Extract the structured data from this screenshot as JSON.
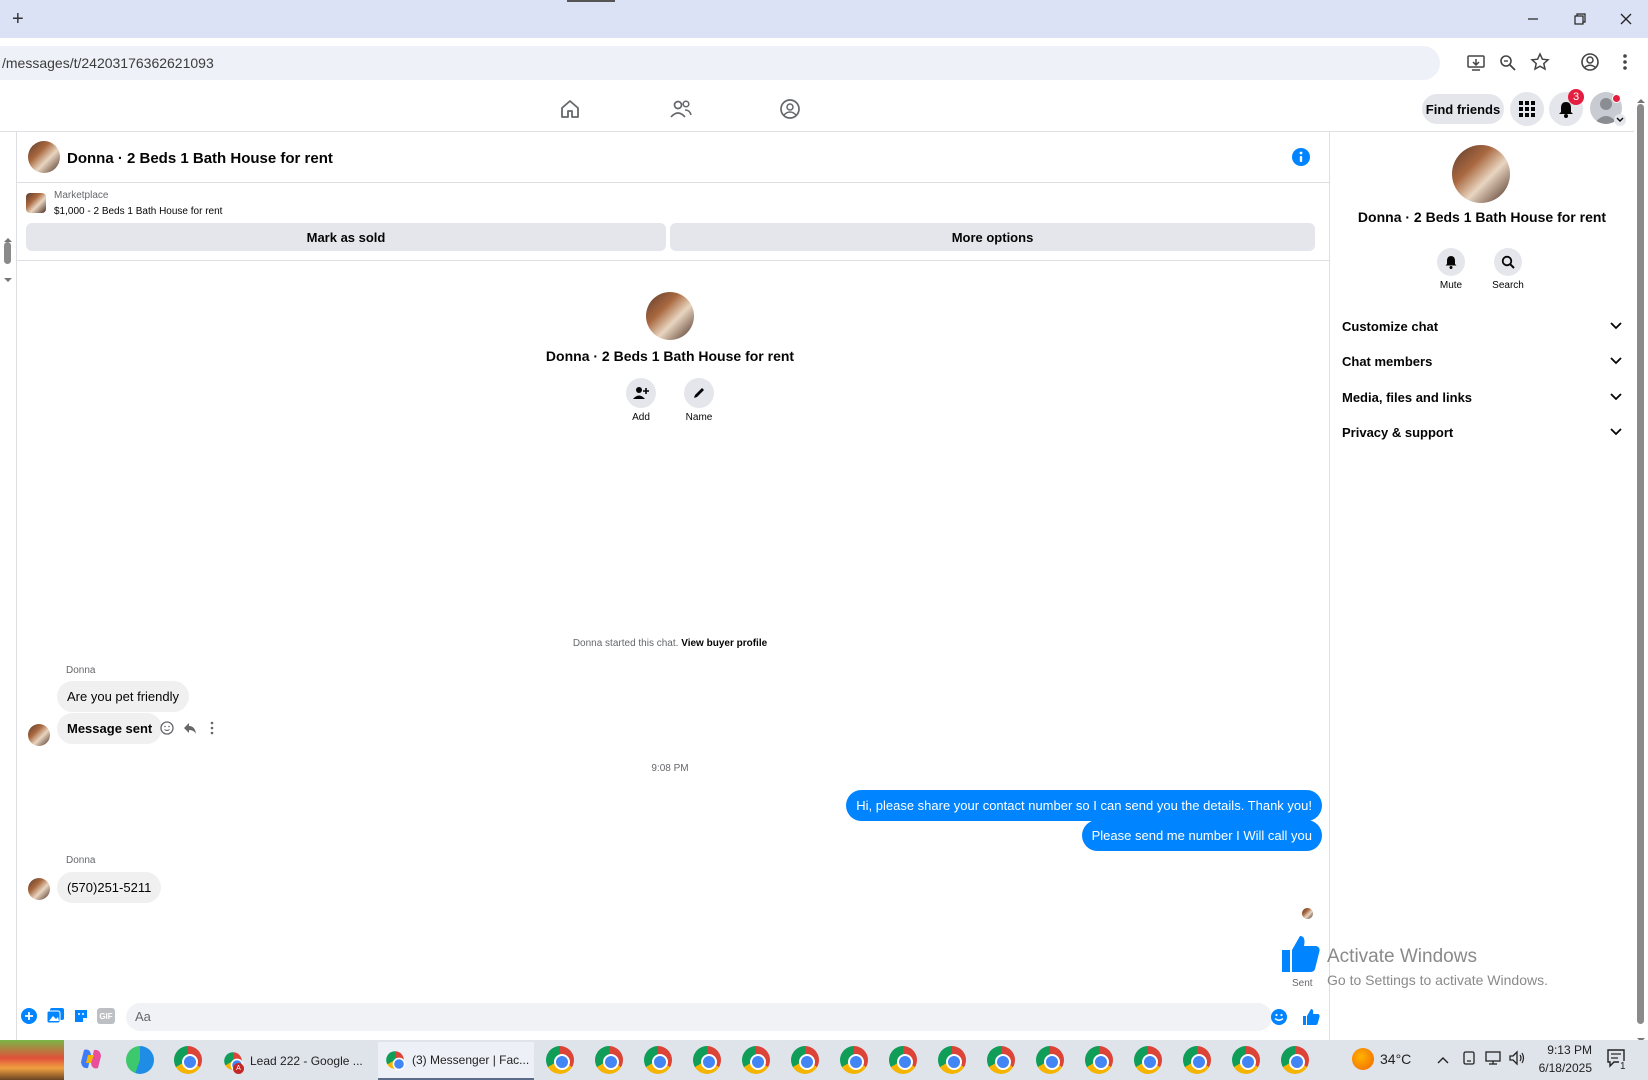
{
  "browser": {
    "url": "/messages/t/24203176362621093",
    "new_tab": "+"
  },
  "header": {
    "find_friends": "Find friends",
    "notification_count": "3"
  },
  "chat": {
    "title": "Donna · 2 Beds 1 Bath House for rent",
    "marketplace_label": "Marketplace",
    "listing": "$1,000 - 2 Beds 1 Bath House for rent",
    "mark_sold": "Mark as sold",
    "more_options": "More options",
    "intro_name": "Donna · 2 Beds 1 Bath House for rent",
    "add_label": "Add",
    "name_label": "Name",
    "started_text": "Donna started this chat.",
    "view_buyer": "View buyer profile",
    "messages": {
      "sender1": "Donna",
      "msg1": "Are you pet friendly",
      "msg2": "Message sent",
      "time": "9:08 PM",
      "out1": "Hi, please share your contact number so I can send you the details. Thank you!",
      "out2": "Please send me number I Will call you",
      "sender2": "Donna",
      "msg3": "(570)251-5211",
      "sent_label": "Sent"
    },
    "composer_placeholder": "Aa"
  },
  "rightpanel": {
    "name": "Donna · 2 Beds 1 Bath House for rent",
    "mute": "Mute",
    "search": "Search",
    "sections": [
      "Customize chat",
      "Chat members",
      "Media, files and links",
      "Privacy & support"
    ]
  },
  "watermark": {
    "line1": "Activate Windows",
    "line2": "Go to Settings to activate Windows."
  },
  "taskbar": {
    "tab1": "Lead 222 - Google ...",
    "tab2": "(3) Messenger | Fac...",
    "temp": "34°C",
    "time": "9:13 PM",
    "date": "6/18/2025",
    "notif_count": "1"
  },
  "colors": {
    "accent": "#0084ff",
    "fb_blue": "#1877f2",
    "badge_red": "#e41e3f"
  }
}
